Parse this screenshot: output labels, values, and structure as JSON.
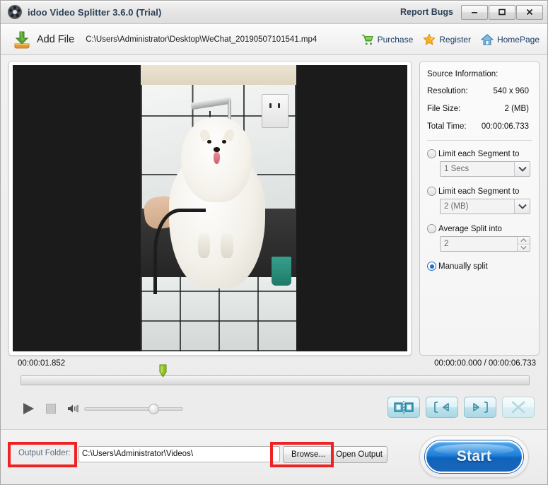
{
  "window": {
    "logo_icon": "film-reel-icon",
    "title": "idoo Video Splitter 3.6.0 (Trial)",
    "report_bugs": "Report Bugs",
    "buttons": [
      {
        "name": "minimize-button",
        "icon": "minimize-icon",
        "label": "–"
      },
      {
        "name": "maximize-button",
        "icon": "maximize-icon",
        "label": "□"
      },
      {
        "name": "close-button",
        "icon": "close-icon",
        "label": "✕"
      }
    ]
  },
  "toolbar": {
    "add_file_label": "Add File",
    "add_file_icon": "download-arrow-icon",
    "file_path": "C:\\Users\\Administrator\\Desktop\\WeChat_20190507101541.mp4",
    "items": [
      {
        "label": "Purchase",
        "icon": "shopping-cart-icon"
      },
      {
        "label": "Register",
        "icon": "star-icon"
      },
      {
        "label": "HomePage",
        "icon": "home-icon"
      }
    ]
  },
  "source_info": {
    "heading": "Source Information:",
    "rows": [
      {
        "key": "Resolution:",
        "value": "540 x 960"
      },
      {
        "key": "File Size:",
        "value": "2 (MB)"
      },
      {
        "key": "Total Time:",
        "value": "00:00:06.733"
      }
    ]
  },
  "split_options": [
    {
      "label": "Limit each Segment to",
      "selected": false,
      "control": "combo",
      "value": "1 Secs"
    },
    {
      "label": "Limit each Segment to",
      "selected": false,
      "control": "combo",
      "value": "2 (MB)"
    },
    {
      "label": "Average Split into",
      "selected": false,
      "control": "spin",
      "value": "2"
    },
    {
      "label": "Manually split",
      "selected": true,
      "control": "none",
      "value": ""
    }
  ],
  "timeline": {
    "current_time": "00:00:01.852",
    "position_total": "00:00:00.000 / 00:00:06.733",
    "marker_icon": "marker-pin-icon",
    "marker_percent": 27.2
  },
  "controls": {
    "play": {
      "label": "Play",
      "icon": "play-icon"
    },
    "stop": {
      "label": "Stop",
      "icon": "stop-icon"
    },
    "volume": {
      "label": "Volume",
      "icon": "speaker-icon",
      "level_percent": 65
    },
    "split_buttons": [
      {
        "name": "split-segment-button",
        "icon": "split-film-icon",
        "enabled": true
      },
      {
        "name": "previous-marker-button",
        "icon": "prev-marker-icon",
        "enabled": true
      },
      {
        "name": "next-marker-button",
        "icon": "next-marker-icon",
        "enabled": true
      },
      {
        "name": "delete-segment-button",
        "icon": "close-x-icon",
        "enabled": false
      }
    ]
  },
  "output": {
    "folder_label": "Output Folder:",
    "folder_path": "C:\\Users\\Administrator\\Videos\\",
    "browse_label": "Browse...",
    "open_output_label": "Open Output",
    "start_label": "Start"
  },
  "annotations": [
    {
      "name": "output-folder-highlight",
      "color": "#ee2222"
    },
    {
      "name": "browse-button-highlight",
      "color": "#ee2222"
    }
  ],
  "video": {
    "description": "white dog on grooming table in tiled room",
    "letterboxed": true
  }
}
